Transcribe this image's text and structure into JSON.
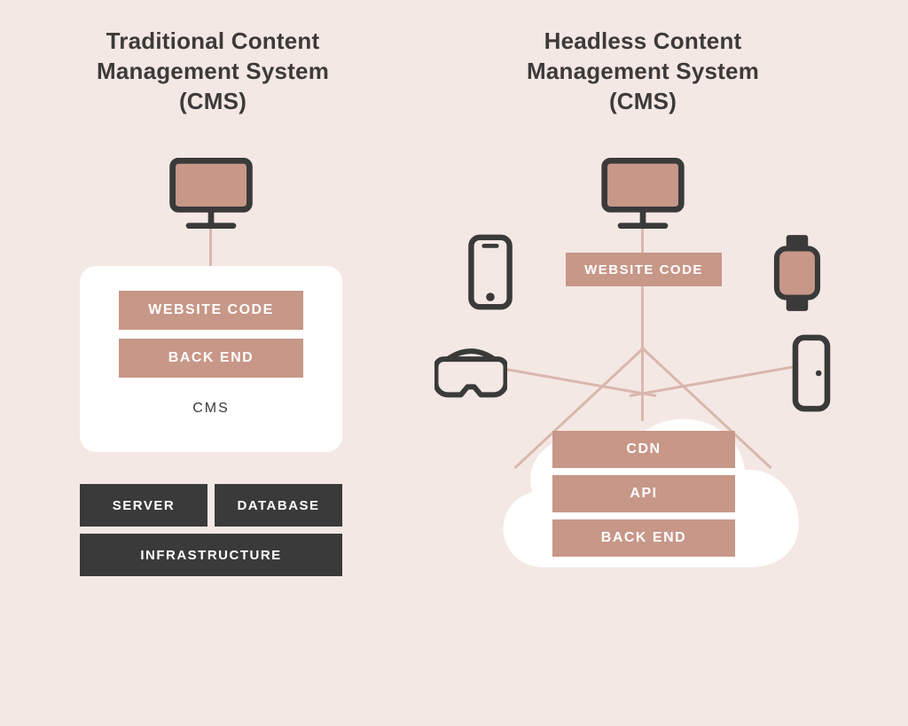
{
  "traditional": {
    "title_l1": "Traditional Content",
    "title_l2": "Management System",
    "title_l3": "(CMS)",
    "website_code": "WEBSITE CODE",
    "back_end": "BACK END",
    "cms_label": "CMS",
    "server": "SERVER",
    "database": "DATABASE",
    "infrastructure": "INFRASTRUCTURE"
  },
  "headless": {
    "title_l1": "Headless Content",
    "title_l2": "Management System",
    "title_l3": "(CMS)",
    "website_code": "WEBSITE CODE",
    "cdn": "CDN",
    "api": "API",
    "back_end": "BACK END"
  }
}
